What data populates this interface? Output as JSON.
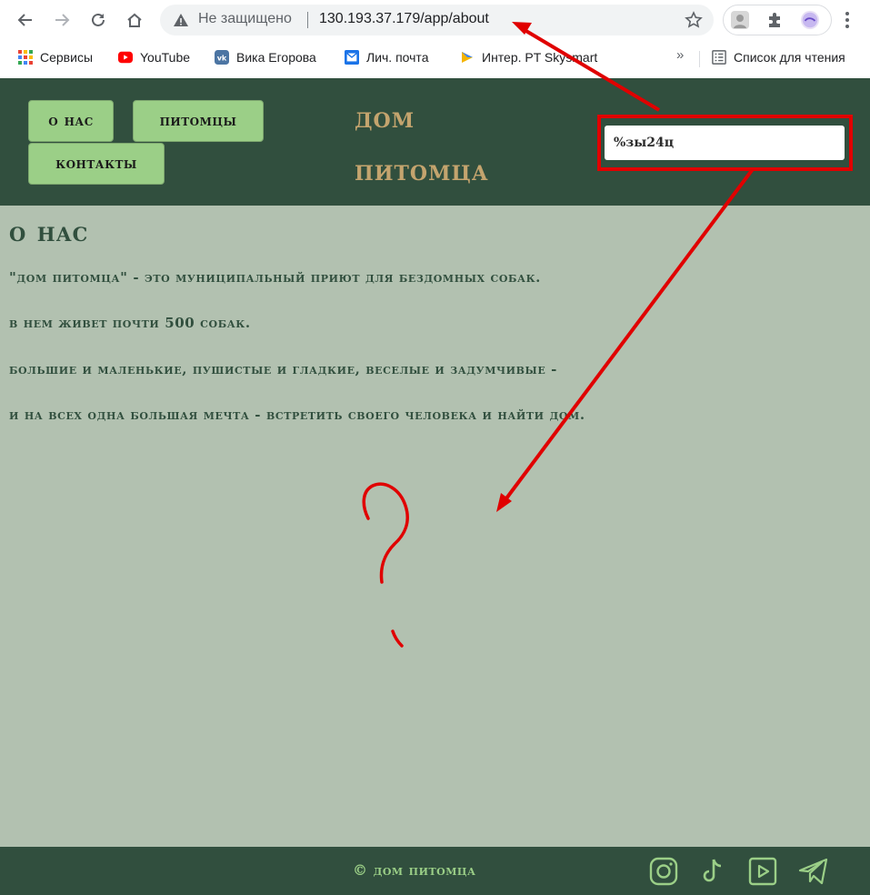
{
  "browser": {
    "status_text": "Не защищено",
    "url": "130.193.37.179/app/about",
    "icons": [
      "back-icon",
      "forward-icon",
      "reload-icon",
      "home-icon",
      "warning-icon",
      "star-icon",
      "extensions-icon",
      "menu-icon"
    ]
  },
  "bookmarks": {
    "items": [
      {
        "label": "Сервисы",
        "icon": "apps-grid-icon"
      },
      {
        "label": "YouTube",
        "icon": "youtube-icon"
      },
      {
        "label": "Вика Егорова",
        "icon": "vk-icon"
      },
      {
        "label": "Лич. почта",
        "icon": "mail-icon"
      },
      {
        "label": "Интер. PT Skysmart",
        "icon": "skysmart-icon"
      }
    ],
    "more": "»",
    "reading_list": "Список для чтения"
  },
  "site": {
    "nav": [
      "о нас",
      "питомцы",
      "контакты"
    ],
    "logo_line1": "дом",
    "logo_line2": "питомца",
    "search_value": "%зы24ц"
  },
  "main": {
    "title": "о нас",
    "paragraphs": [
      "\"дом питомца\" - это муниципальный приют для бездомных собак.",
      "в нем живет почти 500 собак.",
      "большие и маленькие, пушистые и гладкие, веселые и задумчивые -",
      "и на всех одна большая мечта - встретить своего человека и найти дом."
    ]
  },
  "annotation": {
    "mark": "?",
    "color": "#e00000"
  },
  "footer": {
    "copyright": "© дом питомца",
    "social": [
      "instagram-icon",
      "tiktok-icon",
      "youtube-play-icon",
      "telegram-icon"
    ]
  },
  "colors": {
    "header_bg": "#314f3e",
    "content_bg": "#b2c1b0",
    "nav_button": "#9bcf87",
    "logo": "#c4a46e"
  }
}
